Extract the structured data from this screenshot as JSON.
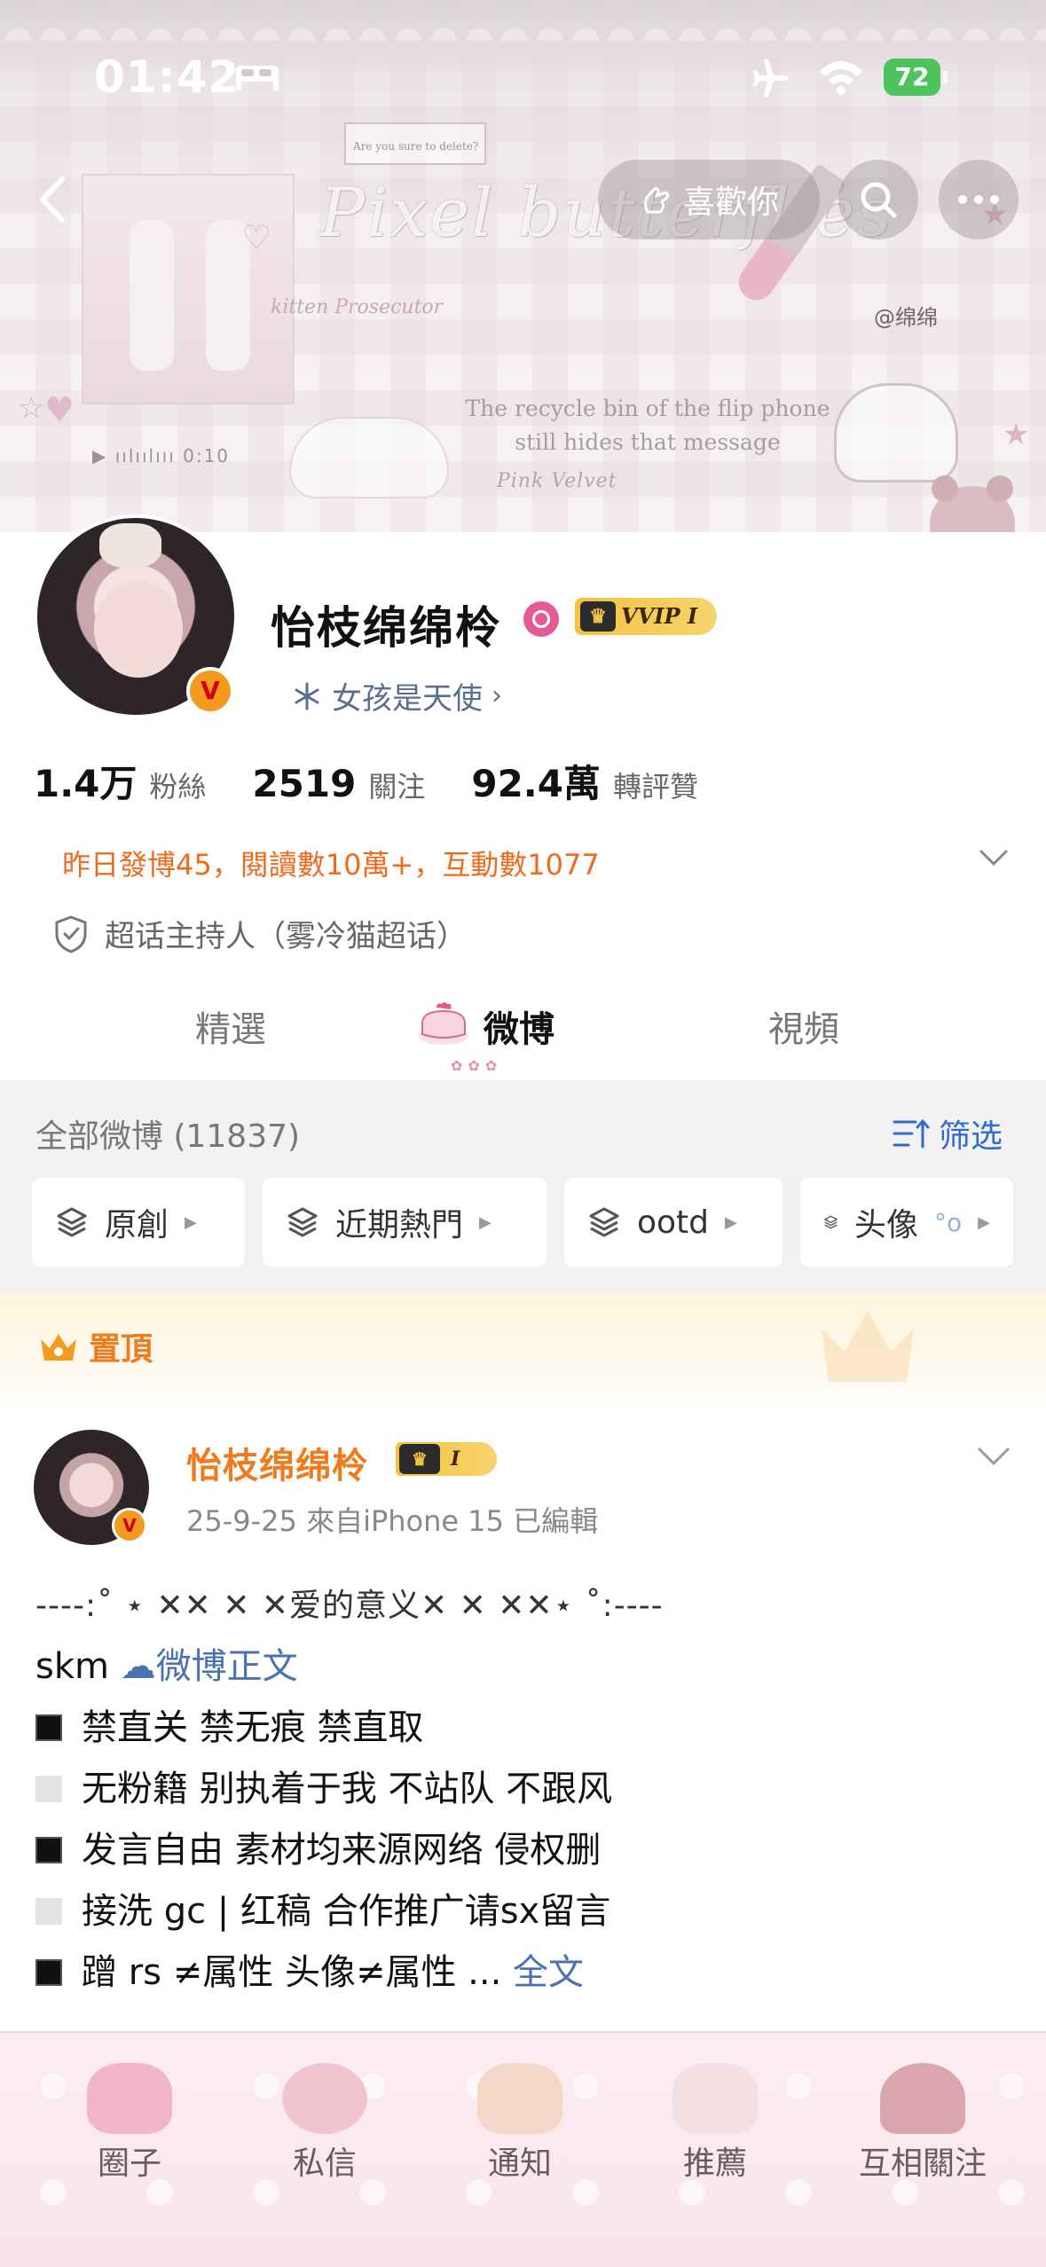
{
  "status_bar": {
    "time": "01:42",
    "battery": "72"
  },
  "banner": {
    "script_title": "Pixel butterflies",
    "sub_title": "kitten Prosecutor",
    "dialog": "Are you sure to delete?",
    "tag": "@绵绵",
    "quote": "The recycle bin of the flip phone still hides that message",
    "pink_velvet": "Pink Velvet",
    "audio": "▶ ıılıılııı 0:10"
  },
  "nav": {
    "like_label": "喜歡你"
  },
  "profile": {
    "name": "怡枝绵绵柃",
    "vip_label": "VVIP I",
    "subtitle": "女孩是天使",
    "stats": [
      {
        "num": "1.4万",
        "label": "粉絲"
      },
      {
        "num": "2519",
        "label": "關注"
      },
      {
        "num": "92.4萬",
        "label": "轉評贊"
      }
    ],
    "activity": "昨日發博45，閱讀數10萬+，互動數1077",
    "host": "超话主持人（雾冷猫超话）"
  },
  "tabs": [
    {
      "label": "精選"
    },
    {
      "label": "微博"
    },
    {
      "label": "視頻"
    }
  ],
  "feed": {
    "all_label": "全部微博 (11837)",
    "sift_label": "筛选",
    "chips": [
      {
        "label": "原創"
      },
      {
        "label": "近期熱門"
      },
      {
        "label": "ootd"
      },
      {
        "label": "头像"
      }
    ]
  },
  "pinned": {
    "label": "置頂"
  },
  "post": {
    "author": "怡枝绵绵柃",
    "badge": "I",
    "meta": "25-9-25  來自iPhone 15  已編輯",
    "line1": "----:˚ ⋆ ✕✕ ✕ ✕爱的意义✕ ✕ ✕✕⋆ ˚:----",
    "line2_prefix": "skm ",
    "line2_link": "微博正文",
    "line3": "禁直关  禁无痕  禁直取",
    "line4": "无粉籍 别执着于我 不站队 不跟风",
    "line5": "发言自由 素材均来源网络 侵权删",
    "line6": "接洗 gc | 红稿  合作推广请sx留言",
    "line7": "蹭 rs ≠属性 头像≠属性 ... ",
    "line7_link": "全文"
  },
  "bottom_nav": [
    {
      "label": "圈子"
    },
    {
      "label": "私信"
    },
    {
      "label": "通知"
    },
    {
      "label": "推薦"
    },
    {
      "label": "互相關注"
    }
  ],
  "colors": {
    "accent_orange": "#ef7b1c",
    "link_blue": "#4b72b0",
    "sift_blue": "#2f6bd3",
    "vip_gold": "#f4c243"
  }
}
